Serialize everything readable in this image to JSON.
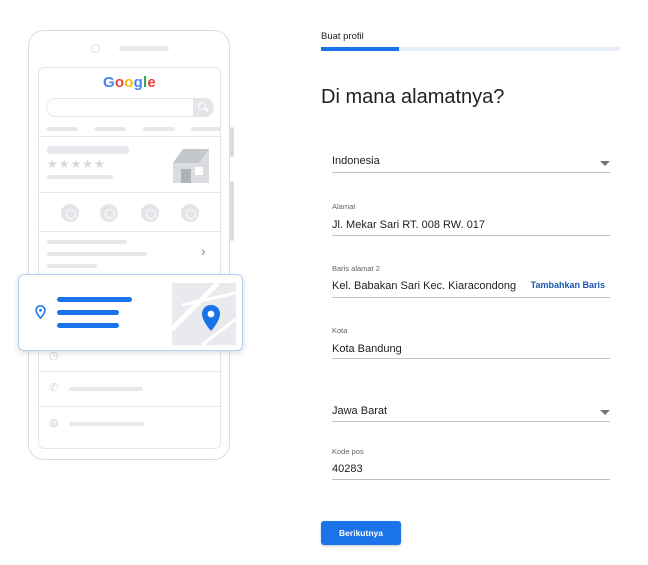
{
  "illustration": {
    "logo_letters": [
      {
        "ch": "G",
        "color": "#4285f4"
      },
      {
        "ch": "o",
        "color": "#ea4335"
      },
      {
        "ch": "o",
        "color": "#fbbc05"
      },
      {
        "ch": "g",
        "color": "#4285f4"
      },
      {
        "ch": "l",
        "color": "#34a853"
      },
      {
        "ch": "e",
        "color": "#ea4335"
      }
    ],
    "stars": "★★★★★",
    "chevron": "›",
    "accent_color": "#1a73e8",
    "icons": [
      "phone-icon",
      "directions-icon",
      "bookmark-icon",
      "globe-icon",
      "location-pin-icon",
      "map-pin-icon",
      "clock-icon",
      "store-icon"
    ]
  },
  "progress": {
    "step_label": "Buat profil",
    "fraction": 0.26
  },
  "title": "Di mana alamatnya?",
  "form": {
    "country": {
      "value": "Indonesia"
    },
    "address": {
      "label": "Alamat",
      "value": "Jl. Mekar Sari RT. 008 RW. 017"
    },
    "address_line2": {
      "label": "Baris alamat 2",
      "value": "Kel. Babakan Sari  Kec. Kiaracondong",
      "add_link": "Tambahkan Baris"
    },
    "city": {
      "label": "Kota",
      "value": "Kota Bandung"
    },
    "province": {
      "value": "Jawa Barat"
    },
    "postal_code": {
      "label": "Kode pos",
      "value": "40283"
    }
  },
  "next_button": "Berikutnya"
}
